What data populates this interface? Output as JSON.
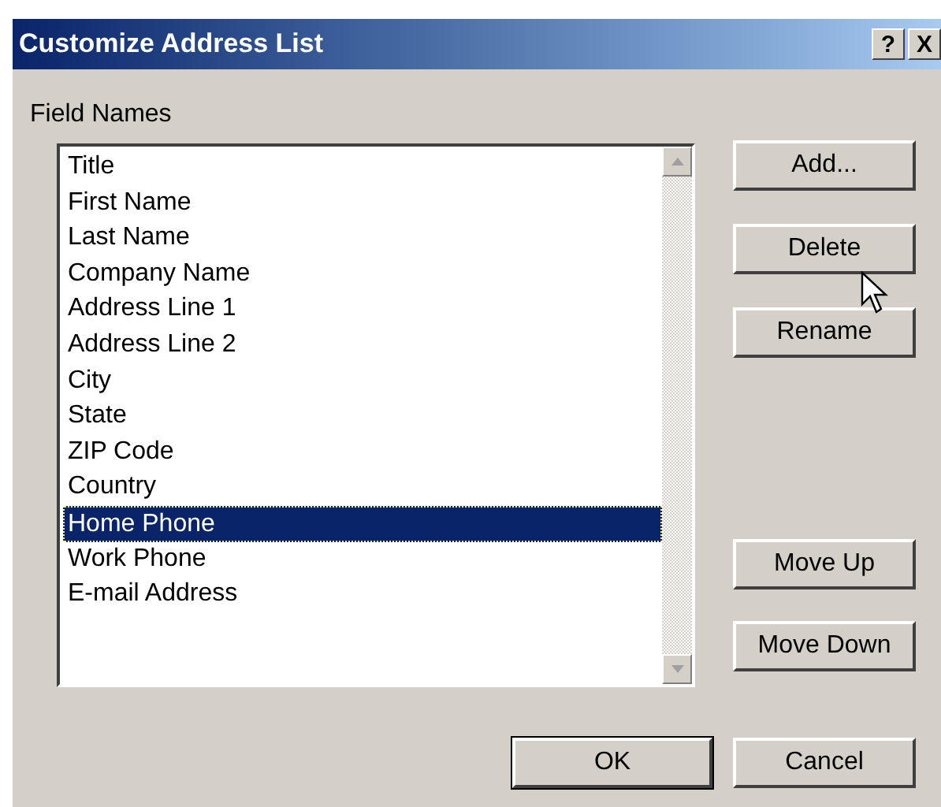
{
  "window": {
    "title": "Customize Address List",
    "title_buttons": [
      "?",
      "X"
    ]
  },
  "field_names": {
    "label": "Field Names",
    "items": [
      {
        "label": "Title",
        "selected": false
      },
      {
        "label": "First Name",
        "selected": false
      },
      {
        "label": "Last Name",
        "selected": false
      },
      {
        "label": "Company Name",
        "selected": false
      },
      {
        "label": "Address Line 1",
        "selected": false
      },
      {
        "label": "Address Line 2",
        "selected": false
      },
      {
        "label": "City",
        "selected": false
      },
      {
        "label": "State",
        "selected": false
      },
      {
        "label": "ZIP Code",
        "selected": false
      },
      {
        "label": "Country",
        "selected": false
      },
      {
        "label": "Home Phone",
        "selected": true
      },
      {
        "label": "Work Phone",
        "selected": false
      },
      {
        "label": "E-mail Address",
        "selected": false
      }
    ]
  },
  "side_buttons": [
    "Add...",
    "Delete",
    "Rename"
  ],
  "move_buttons": [
    "Move Up",
    "Move Down"
  ],
  "footer_buttons": [
    "OK",
    "Cancel"
  ]
}
